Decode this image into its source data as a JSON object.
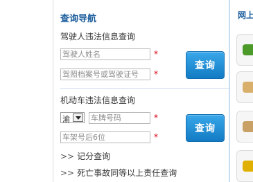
{
  "panel": {
    "title": "查询导航",
    "driver": {
      "label": "驾驶人违法信息查询",
      "name_placeholder": "驾驶人姓名",
      "license_placeholder": "驾照档案号或驾驶证号",
      "query_button": "查询"
    },
    "vehicle": {
      "label": "机动车违法信息查询",
      "province_selected": "渝",
      "plate_placeholder": "车牌号码",
      "frame_placeholder": "车架号后6位",
      "query_button": "查询"
    },
    "links": [
      {
        "arrow": ">>",
        "label": "记分查询"
      },
      {
        "arrow": ">>",
        "label": "死亡事故同等以上责任查询"
      }
    ],
    "required_mark": "*"
  },
  "right": {
    "title": "网上"
  },
  "colors": {
    "accent": "#1b5d9c",
    "button": "#1f8bd4",
    "required": "#d7000f"
  }
}
